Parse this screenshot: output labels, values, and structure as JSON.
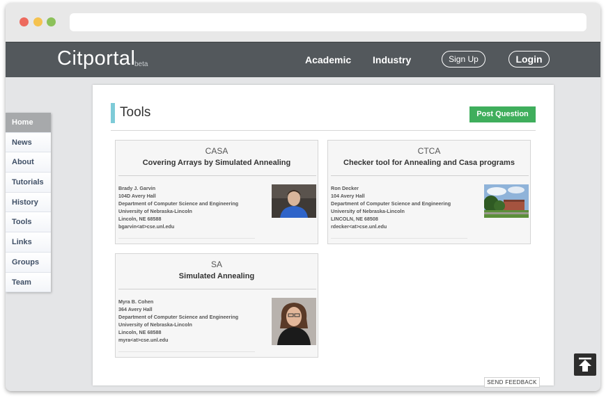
{
  "navbar": {
    "brand": "Citportal",
    "brand_tag": "beta",
    "links": [
      "Academic",
      "Industry"
    ],
    "signup": "Sign Up",
    "login": "Login"
  },
  "sidebar": {
    "items": [
      "Home",
      "News",
      "About",
      "Tutorials",
      "History",
      "Tools",
      "Links",
      "Groups",
      "Team"
    ],
    "active": "Home"
  },
  "main": {
    "title": "Tools",
    "post_button": "Post Question",
    "tools": [
      {
        "abbr": "CASA",
        "name": "Covering Arrays by Simulated Annealing",
        "contact": [
          "Brady J. Garvin",
          "104D Avery Hall",
          "Department of Computer Science and Engineering",
          "University of Nebraska-Lincoln",
          "Lincoln, NE 68588",
          "bgarvin<at>cse.unl.edu"
        ],
        "photo": "portrait-photo"
      },
      {
        "abbr": "CTCA",
        "name": "Checker tool for Annealing and Casa programs",
        "contact": [
          "Ron Decker",
          "104 Avery Hall",
          "Department of Computer Science and Engineering",
          "University of Nebraska-Lincoln",
          "LINCOLN, NE 68508",
          "rdecker<at>cse.unl.edu"
        ],
        "photo": "building-photo"
      },
      {
        "abbr": "SA",
        "name": "Simulated Annealing",
        "contact": [
          "Myra B. Cohen",
          "364 Avery Hall",
          "Department of Computer Science and Engineering",
          "University of Nebraska-Lincoln",
          "Lincoln, NE 68588",
          "myra<at>cse.unl.edu"
        ],
        "photo": "portrait-photo"
      }
    ]
  },
  "feedback": "SEND FEEDBACK",
  "icons": {
    "back_to_top": "arrow-up-icon"
  },
  "colors": {
    "accent": "#7ecbd8",
    "post_button": "#3fae5c",
    "navbar": "#53585c"
  }
}
